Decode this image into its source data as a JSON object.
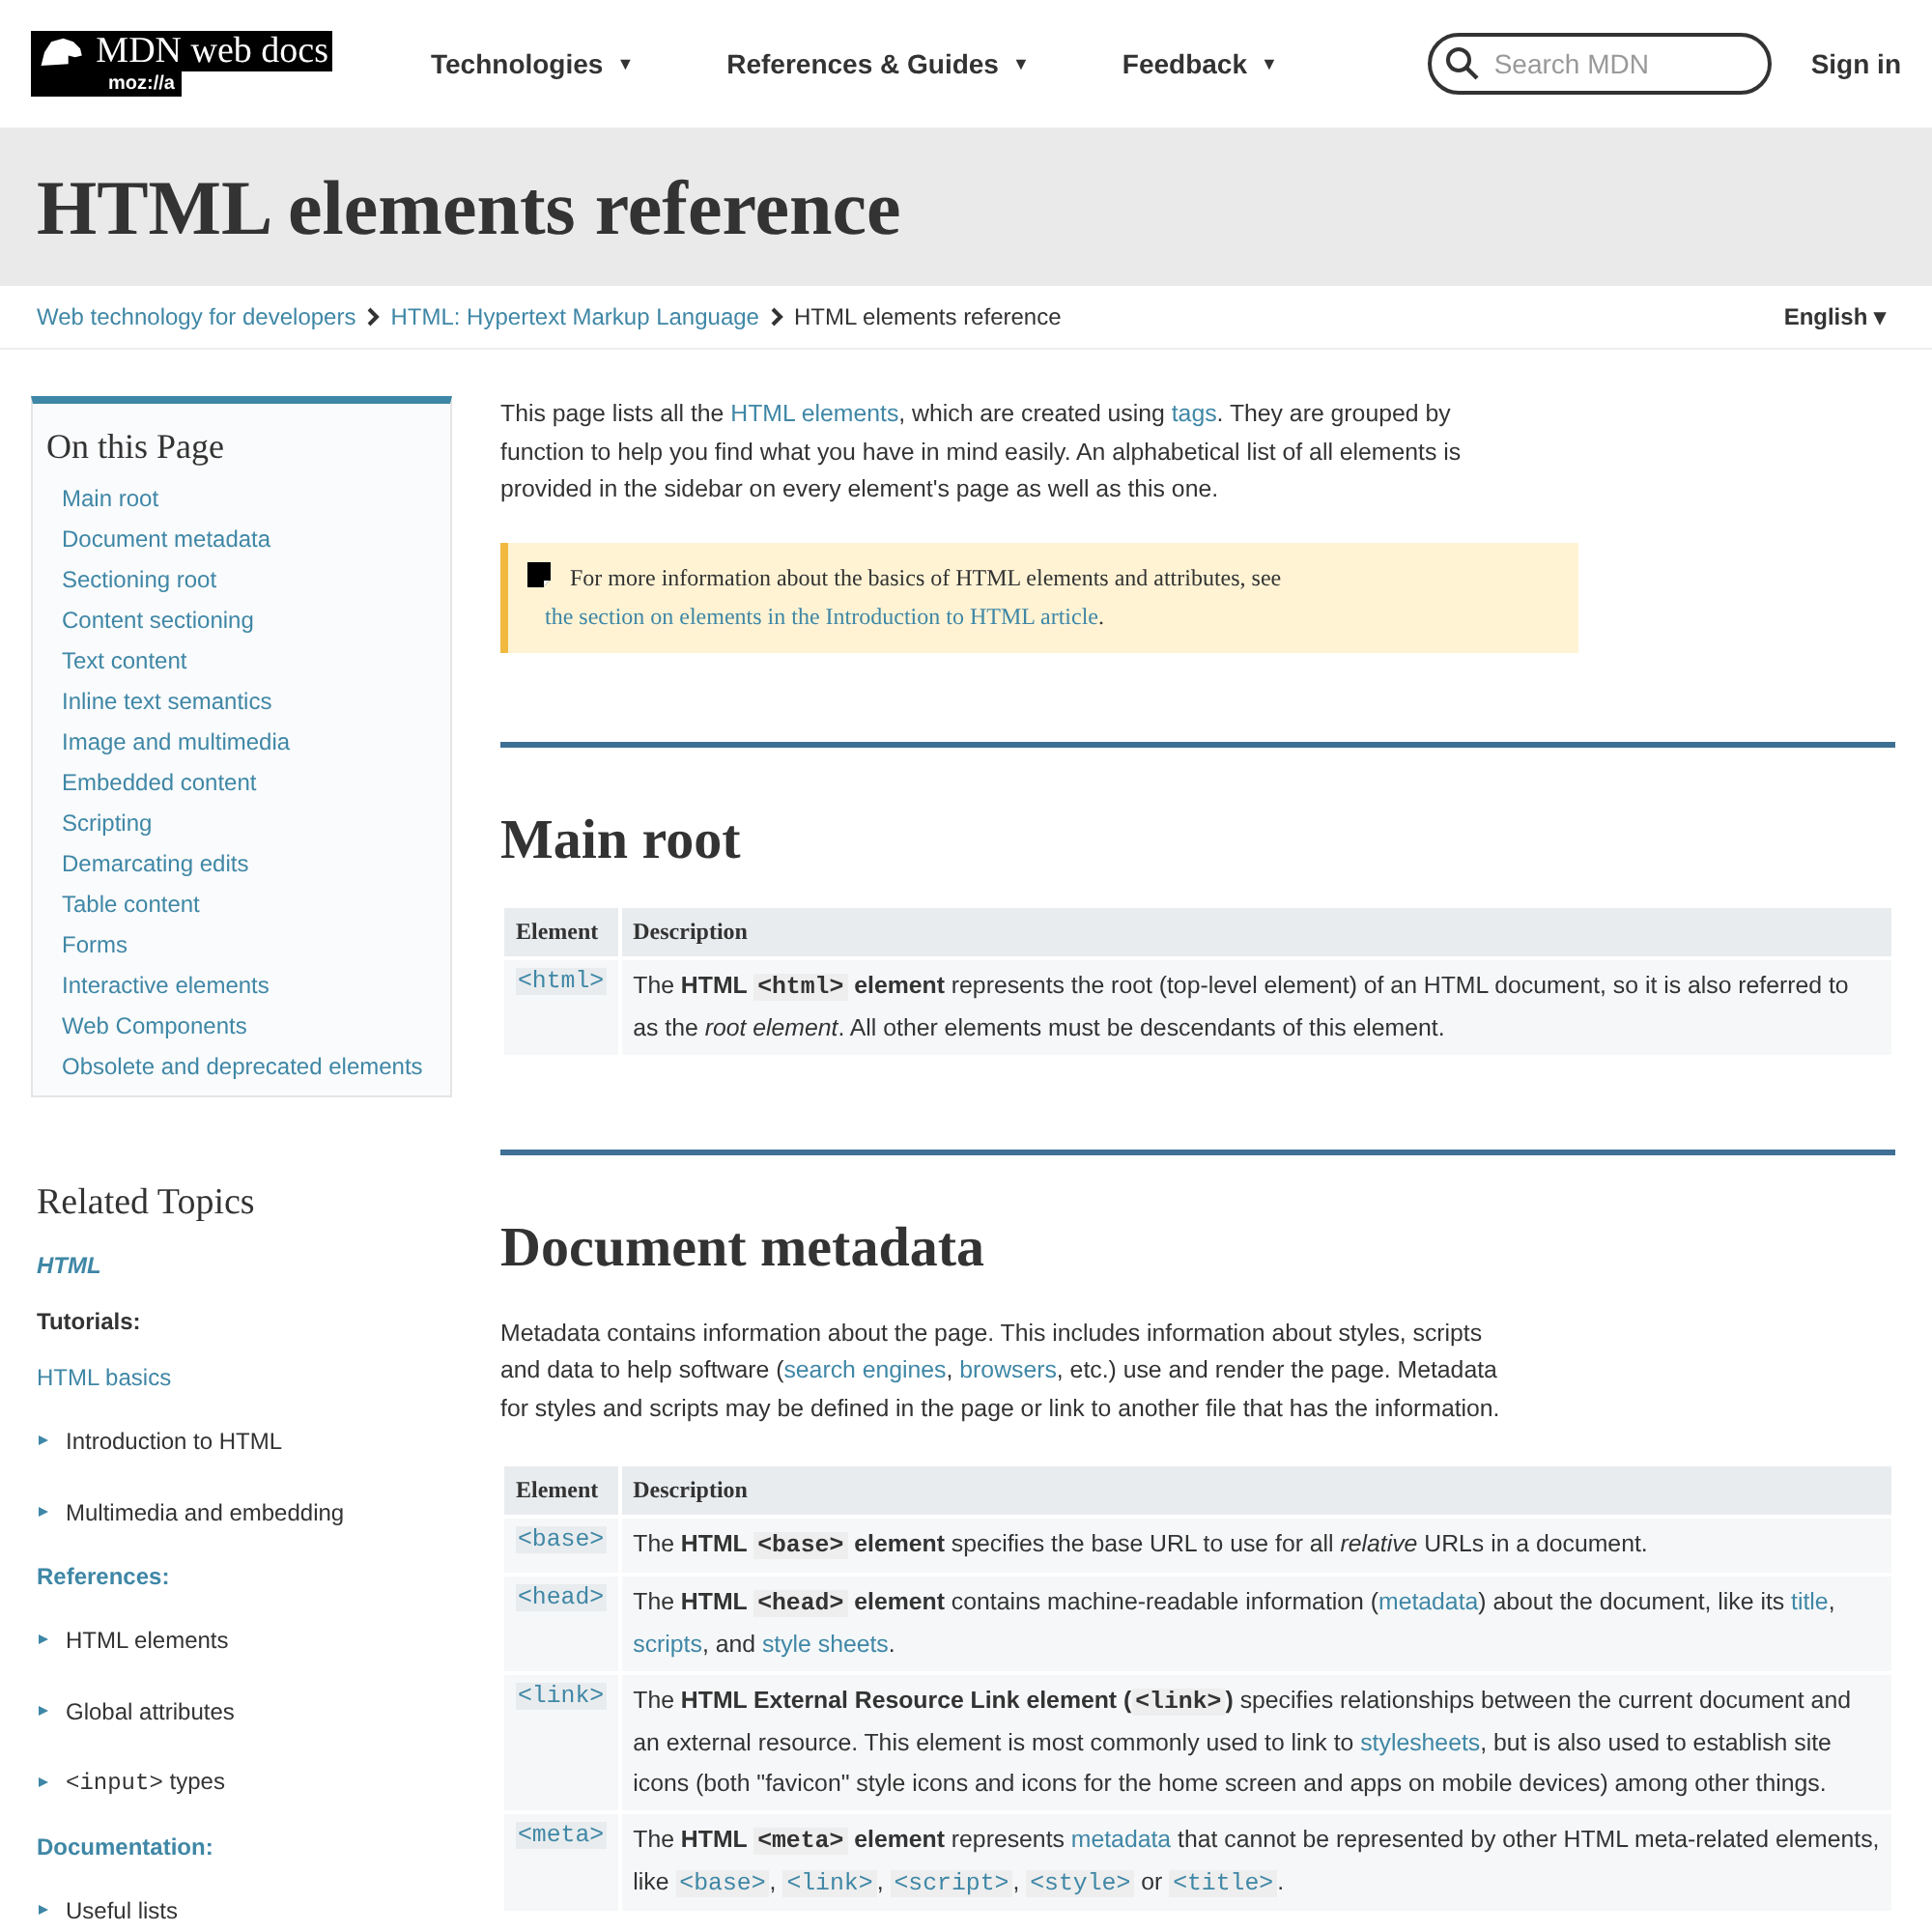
{
  "header": {
    "logo": {
      "title": "MDN web docs",
      "sub": "moz://a"
    },
    "nav": [
      {
        "label": "Technologies",
        "caret": "▼"
      },
      {
        "label": "References & Guides",
        "caret": "▼"
      },
      {
        "label": "Feedback",
        "caret": "▼"
      }
    ],
    "search": {
      "placeholder": "Search MDN"
    },
    "sign_in": "Sign in"
  },
  "title": "HTML elements reference",
  "breadcrumbs": [
    {
      "label": "Web technology for developers",
      "current": false
    },
    {
      "label": "HTML: Hypertext Markup Language",
      "current": false
    },
    {
      "label": "HTML elements reference",
      "current": true
    }
  ],
  "language": {
    "label": "English",
    "caret": "▾"
  },
  "toc": {
    "title": "On this Page",
    "items": [
      "Main root",
      "Document metadata",
      "Sectioning root",
      "Content sectioning",
      "Text content",
      "Inline text semantics",
      "Image and multimedia",
      "Embedded content",
      "Scripting",
      "Demarcating edits",
      "Table content",
      "Forms",
      "Interactive elements",
      "Web Components",
      "Obsolete and deprecated elements"
    ]
  },
  "related": {
    "title": "Related Topics",
    "items": [
      {
        "kind": "topic",
        "parts": [
          {
            "kind": "text",
            "text": "HTML"
          }
        ]
      },
      {
        "kind": "heading",
        "parts": [
          {
            "kind": "text",
            "text": "Tutorials:"
          }
        ]
      },
      {
        "kind": "link",
        "parts": [
          {
            "kind": "text",
            "text": "HTML basics"
          }
        ]
      },
      {
        "kind": "expander",
        "parts": [
          {
            "kind": "text",
            "text": "Introduction to HTML"
          }
        ]
      },
      {
        "kind": "expander",
        "parts": [
          {
            "kind": "text",
            "text": "Multimedia and embedding"
          }
        ]
      },
      {
        "kind": "heading-link",
        "parts": [
          {
            "kind": "text",
            "text": "References:"
          }
        ]
      },
      {
        "kind": "expander",
        "parts": [
          {
            "kind": "text",
            "text": "HTML elements"
          }
        ]
      },
      {
        "kind": "expander",
        "parts": [
          {
            "kind": "text",
            "text": "Global attributes"
          }
        ]
      },
      {
        "kind": "expander",
        "parts": [
          {
            "kind": "code",
            "text": "<input>"
          },
          {
            "kind": "text",
            "text": " types"
          }
        ]
      },
      {
        "kind": "heading-link",
        "parts": [
          {
            "kind": "text",
            "text": "Documentation:"
          }
        ]
      },
      {
        "kind": "expander",
        "parts": [
          {
            "kind": "text",
            "text": "Useful lists"
          }
        ]
      }
    ]
  },
  "intro": [
    {
      "kind": "text",
      "text": "This page lists all the "
    },
    {
      "kind": "link",
      "text": "HTML elements"
    },
    {
      "kind": "text",
      "text": ", which are created using "
    },
    {
      "kind": "link",
      "text": "tags"
    },
    {
      "kind": "text",
      "text": ". They are grouped by function to help you find what you have in mind easily. An alphabetical list of all elements is provided in the sidebar on every element's page as well as this one."
    }
  ],
  "note": [
    {
      "kind": "text",
      "text": "For more information about the basics of HTML elements and attributes, see "
    },
    {
      "kind": "link",
      "text": "the section on elements in the Introduction to HTML article"
    },
    {
      "kind": "text",
      "text": "."
    }
  ],
  "sections": [
    {
      "title": "Main root",
      "table": {
        "columns": [
          "Element",
          "Description"
        ],
        "rows": [
          {
            "element": "<html>",
            "description": [
              {
                "kind": "text",
                "text": "The "
              },
              {
                "kind": "bold",
                "text": "HTML "
              },
              {
                "kind": "bold-code",
                "text": "<html>"
              },
              {
                "kind": "bold",
                "text": " element"
              },
              {
                "kind": "text",
                "text": " represents the root (top-level element) of an HTML document, so it is also referred to as the "
              },
              {
                "kind": "italic",
                "text": "root element"
              },
              {
                "kind": "text",
                "text": ". All other elements must be descendants of this element."
              }
            ]
          }
        ]
      }
    },
    {
      "title": "Document metadata",
      "intro": [
        {
          "kind": "text",
          "text": "Metadata contains information about the page. This includes information about styles, scripts and data to help software ("
        },
        {
          "kind": "link",
          "text": "search engines"
        },
        {
          "kind": "text",
          "text": ", "
        },
        {
          "kind": "link",
          "text": "browsers"
        },
        {
          "kind": "text",
          "text": ", etc.) use and render the page. Metadata for styles and scripts may be defined in the page or link to another file that has the information."
        }
      ],
      "table": {
        "columns": [
          "Element",
          "Description"
        ],
        "rows": [
          {
            "element": "<base>",
            "description": [
              {
                "kind": "text",
                "text": "The "
              },
              {
                "kind": "bold",
                "text": "HTML "
              },
              {
                "kind": "bold-code",
                "text": "<base>"
              },
              {
                "kind": "bold",
                "text": " element"
              },
              {
                "kind": "text",
                "text": " specifies the base URL to use for all "
              },
              {
                "kind": "italic",
                "text": "relative"
              },
              {
                "kind": "text",
                "text": " URLs in a document."
              }
            ]
          },
          {
            "element": "<head>",
            "description": [
              {
                "kind": "text",
                "text": "The "
              },
              {
                "kind": "bold",
                "text": "HTML "
              },
              {
                "kind": "bold-code",
                "text": "<head>"
              },
              {
                "kind": "bold",
                "text": " element"
              },
              {
                "kind": "text",
                "text": " contains machine-readable information ("
              },
              {
                "kind": "link",
                "text": "metadata"
              },
              {
                "kind": "text",
                "text": ") about the document, like its "
              },
              {
                "kind": "link",
                "text": "title"
              },
              {
                "kind": "text",
                "text": ", "
              },
              {
                "kind": "link",
                "text": "scripts"
              },
              {
                "kind": "text",
                "text": ", and "
              },
              {
                "kind": "link",
                "text": "style sheets"
              },
              {
                "kind": "text",
                "text": "."
              }
            ]
          },
          {
            "element": "<link>",
            "description": [
              {
                "kind": "text",
                "text": "The "
              },
              {
                "kind": "bold",
                "text": "HTML External Resource Link element ("
              },
              {
                "kind": "bold-code",
                "text": "<link>"
              },
              {
                "kind": "bold",
                "text": ")"
              },
              {
                "kind": "text",
                "text": " specifies relationships between the current document and an external resource. This element is most commonly used to link to "
              },
              {
                "kind": "link",
                "text": "stylesheets"
              },
              {
                "kind": "text",
                "text": ", but is also used to establish site icons (both \"favicon\" style icons and icons for the home screen and apps on mobile devices) among other things."
              }
            ]
          },
          {
            "element": "<meta>",
            "description": [
              {
                "kind": "text",
                "text": "The "
              },
              {
                "kind": "bold",
                "text": "HTML "
              },
              {
                "kind": "bold-code",
                "text": "<meta>"
              },
              {
                "kind": "bold",
                "text": " element"
              },
              {
                "kind": "text",
                "text": " represents "
              },
              {
                "kind": "link",
                "text": "metadata"
              },
              {
                "kind": "text",
                "text": " that cannot be represented by other HTML meta-related elements, like "
              },
              {
                "kind": "code-link",
                "text": "<base>"
              },
              {
                "kind": "text",
                "text": ", "
              },
              {
                "kind": "code-link",
                "text": "<link>"
              },
              {
                "kind": "text",
                "text": ", "
              },
              {
                "kind": "code-link",
                "text": "<script>"
              },
              {
                "kind": "text",
                "text": ", "
              },
              {
                "kind": "code-link",
                "text": "<style>"
              },
              {
                "kind": "text",
                "text": " or "
              },
              {
                "kind": "code-link",
                "text": "<title>"
              },
              {
                "kind": "text",
                "text": "."
              }
            ]
          }
        ]
      }
    }
  ]
}
